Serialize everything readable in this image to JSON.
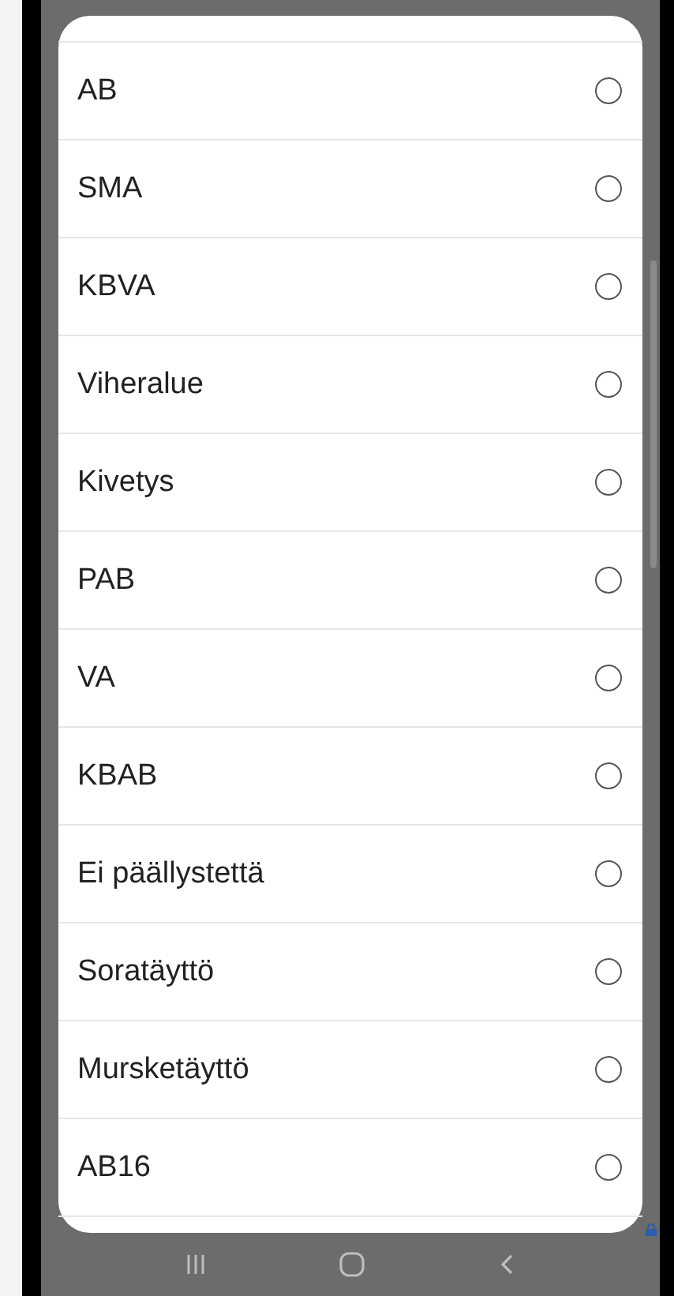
{
  "options": [
    {
      "label": "AB",
      "selected": false
    },
    {
      "label": "SMA",
      "selected": false
    },
    {
      "label": "KBVA",
      "selected": false
    },
    {
      "label": "Viheralue",
      "selected": false
    },
    {
      "label": "Kivetys",
      "selected": false
    },
    {
      "label": "PAB",
      "selected": false
    },
    {
      "label": "VA",
      "selected": false
    },
    {
      "label": "KBAB",
      "selected": false
    },
    {
      "label": "Ei päällystettä",
      "selected": false
    },
    {
      "label": "Soratäyttö",
      "selected": false
    },
    {
      "label": "Mursketäyttö",
      "selected": false
    },
    {
      "label": "AB16",
      "selected": false
    }
  ]
}
